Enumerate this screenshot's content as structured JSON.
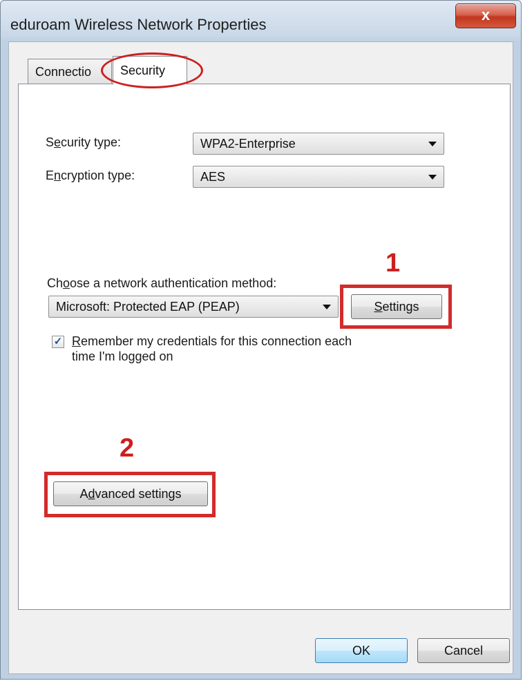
{
  "window": {
    "title": "eduroam Wireless Network Properties",
    "close_glyph": "x"
  },
  "tabs": [
    {
      "label": "Connection",
      "visible_label": "Connectio"
    },
    {
      "label": "Security"
    }
  ],
  "security": {
    "security_type": {
      "label_pre": "S",
      "label_u": "e",
      "label_post": "curity type:",
      "value": "WPA2-Enterprise"
    },
    "encryption_type": {
      "label_pre": "E",
      "label_u": "n",
      "label_post": "cryption type:",
      "value": "AES"
    },
    "auth_method": {
      "label_pre": "Ch",
      "label_u": "o",
      "label_post": "ose a network authentication method:",
      "value": "Microsoft: Protected EAP (PEAP)",
      "settings_u": "S",
      "settings_post": "ettings"
    },
    "remember": {
      "checked": true,
      "check_glyph": "✓",
      "label_u": "R",
      "label_line1": "emember my credentials for this connection each",
      "label_line2": "time I'm logged on"
    },
    "advanced": {
      "pre": "A",
      "u": "d",
      "post": "vanced settings"
    }
  },
  "annotations": {
    "step1": "1",
    "step2": "2",
    "highlight_color": "#d32b2b"
  },
  "footer": {
    "ok": "OK",
    "cancel": "Cancel"
  }
}
